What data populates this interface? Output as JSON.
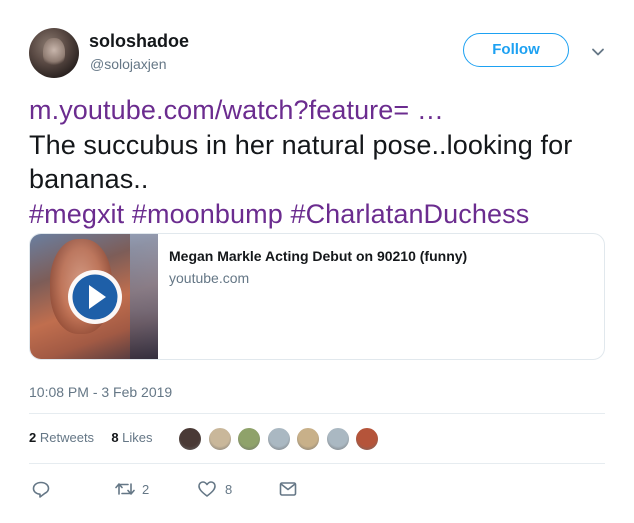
{
  "user": {
    "display_name": "soloshadoe",
    "handle": "@solojaxjen"
  },
  "follow_button": {
    "label": "Follow"
  },
  "tweet": {
    "link_text": "m.youtube.com/watch?feature= …",
    "body_text": "The succubus in her natural pose..looking for bananas..",
    "hashtags": [
      "#megxit",
      "#moonbump",
      "#CharlatanDuchess"
    ]
  },
  "card": {
    "title": "Megan Markle Acting Debut on 90210 (funny)",
    "domain": "youtube.com"
  },
  "timestamp": "10:08 PM - 3 Feb 2019",
  "stats": {
    "retweets_count": "2",
    "retweets_label": "Retweets",
    "likes_count": "8",
    "likes_label": "Likes"
  },
  "liker_avatars": [
    {
      "color": "#4a3a36"
    },
    {
      "color": "#c9b79a"
    },
    {
      "color": "#8fa26a"
    },
    {
      "color": "#aab8c2"
    },
    {
      "color": "#c8b089"
    },
    {
      "color": "#aab8c2"
    },
    {
      "color": "#b5543a"
    }
  ],
  "actions": {
    "reply_count": "",
    "retweet_count": "2",
    "like_count": "8"
  },
  "colors": {
    "link": "#6b2c8f",
    "follow": "#1da1f2",
    "muted": "#657786"
  },
  "icons": [
    "chevron-down-icon",
    "play-icon",
    "reply-icon",
    "retweet-icon",
    "heart-icon",
    "message-icon"
  ]
}
